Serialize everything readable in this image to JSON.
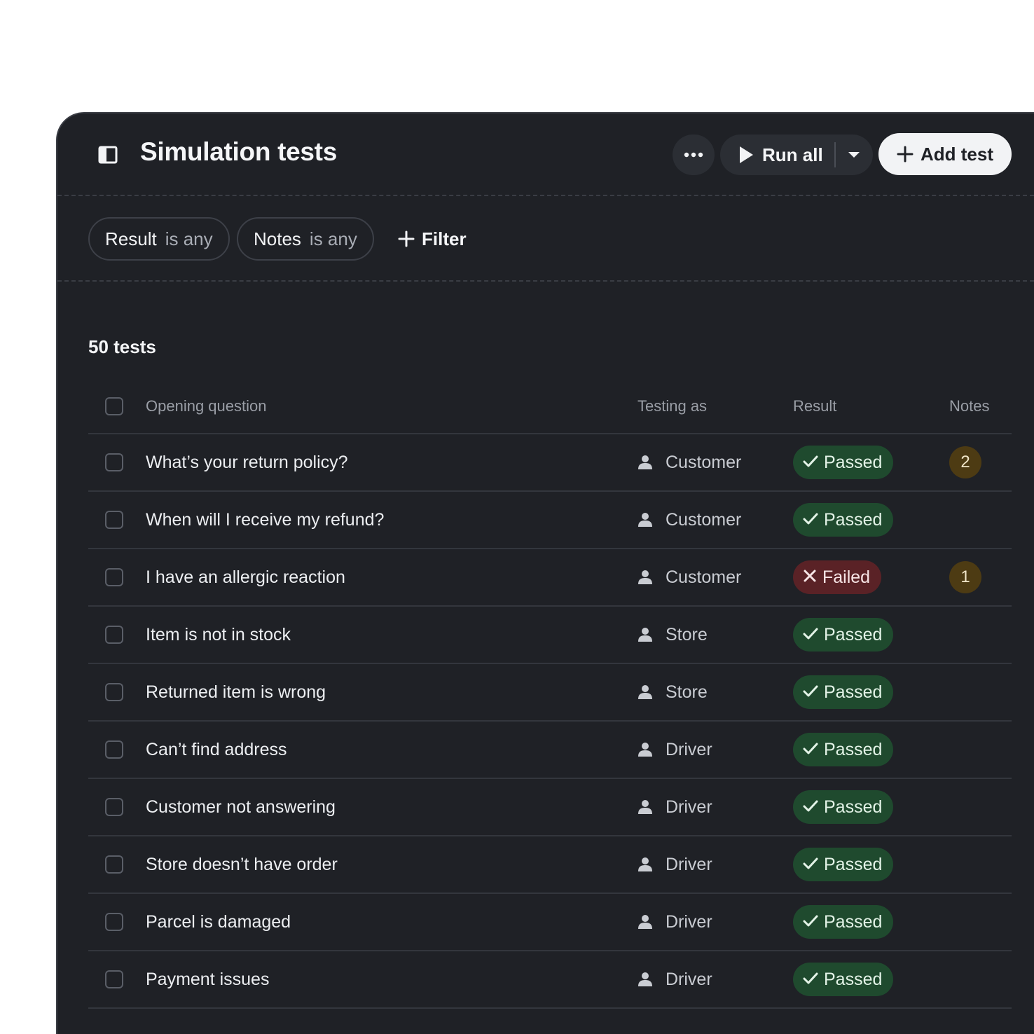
{
  "header": {
    "title": "Simulation tests",
    "run_all_label": "Run all",
    "add_test_label": "Add test"
  },
  "filters": [
    {
      "field": "Result",
      "operator": "is any"
    },
    {
      "field": "Notes",
      "operator": "is any"
    }
  ],
  "add_filter_label": "Filter",
  "tests_count": "50 tests",
  "table": {
    "columns": {
      "question": "Opening question",
      "testing_as": "Testing as",
      "result": "Result",
      "notes": "Notes"
    },
    "rows": [
      {
        "question": "What’s your return policy?",
        "testing_as": "Customer",
        "result": "Passed",
        "status": "passed",
        "notes": "2"
      },
      {
        "question": "When will I receive my refund?",
        "testing_as": "Customer",
        "result": "Passed",
        "status": "passed",
        "notes": ""
      },
      {
        "question": "I have an allergic reaction",
        "testing_as": "Customer",
        "result": "Failed",
        "status": "failed",
        "notes": "1"
      },
      {
        "question": "Item is not in stock",
        "testing_as": "Store",
        "result": "Passed",
        "status": "passed",
        "notes": ""
      },
      {
        "question": "Returned item is wrong",
        "testing_as": "Store",
        "result": "Passed",
        "status": "passed",
        "notes": ""
      },
      {
        "question": "Can’t find address",
        "testing_as": "Driver",
        "result": "Passed",
        "status": "passed",
        "notes": ""
      },
      {
        "question": "Customer not answering",
        "testing_as": "Driver",
        "result": "Passed",
        "status": "passed",
        "notes": ""
      },
      {
        "question": "Store doesn’t have order",
        "testing_as": "Driver",
        "result": "Passed",
        "status": "passed",
        "notes": ""
      },
      {
        "question": "Parcel is damaged",
        "testing_as": "Driver",
        "result": "Passed",
        "status": "passed",
        "notes": ""
      },
      {
        "question": "Payment issues",
        "testing_as": "Driver",
        "result": "Passed",
        "status": "passed",
        "notes": ""
      }
    ]
  },
  "icons": {
    "sidebar_toggle": "sidebar-toggle-icon",
    "more": "more-horizontal-icon",
    "run": "play-icon",
    "dropdown": "chevron-down-icon",
    "add": "plus-icon",
    "person": "person-icon",
    "passed": "check-icon",
    "failed": "x-icon"
  },
  "colors": {
    "background": "#1f2126",
    "passed_badge": "#1f4a2e",
    "failed_badge": "#5a2226",
    "note_badge": "#4d3b13"
  }
}
